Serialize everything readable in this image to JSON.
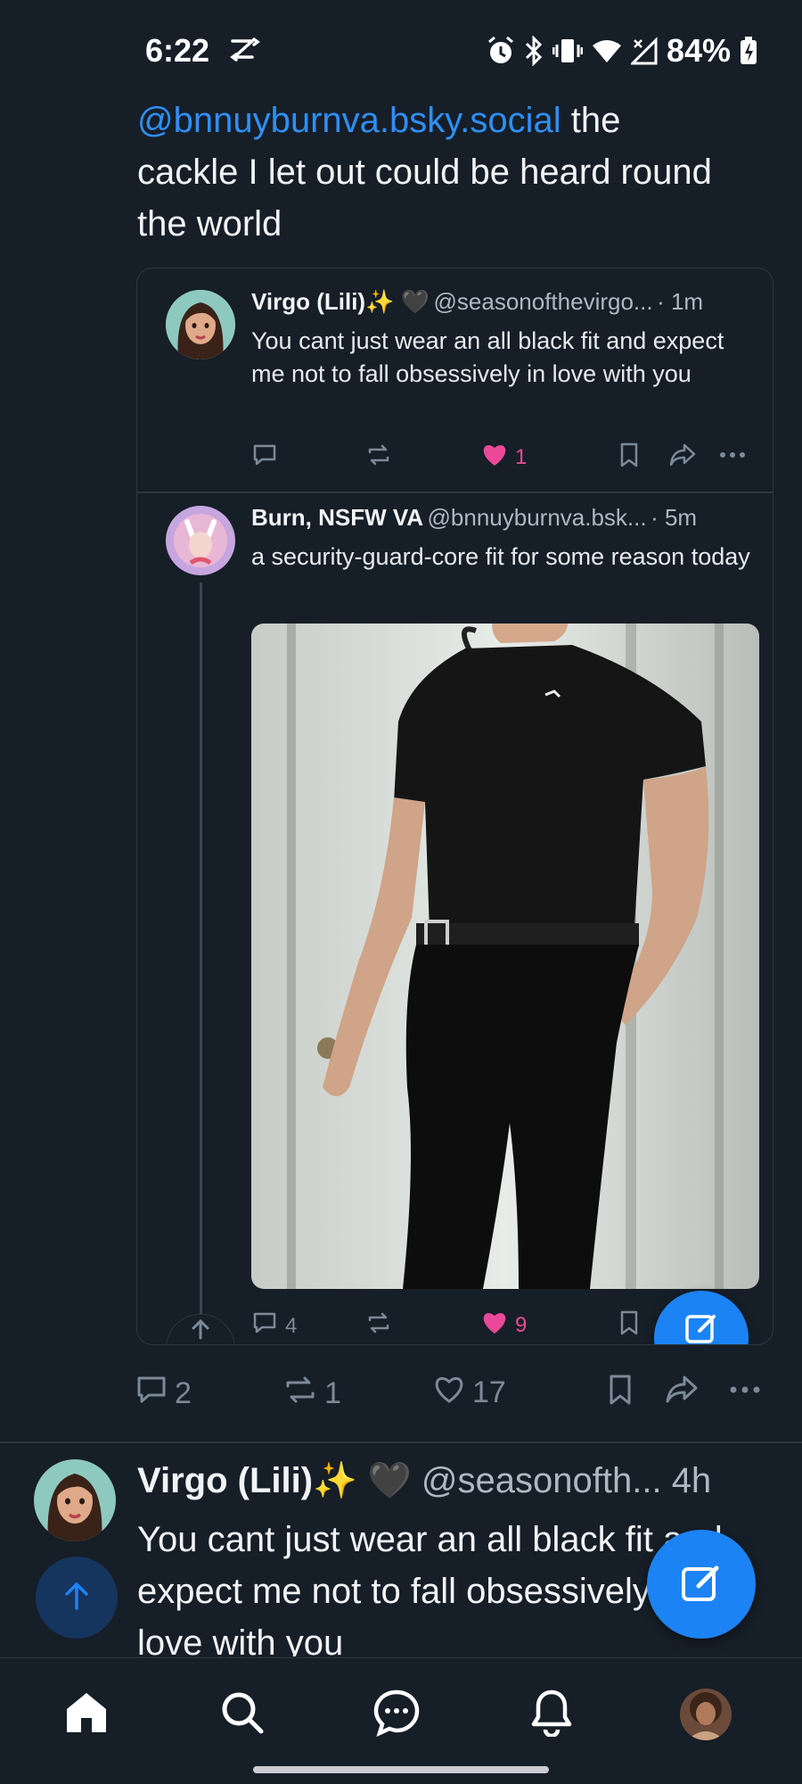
{
  "status_bar": {
    "time": "6:22",
    "battery": "84%",
    "icons": [
      "sync-icon",
      "alarm-icon",
      "bluetooth-icon",
      "vibrate-icon",
      "wifi-icon",
      "no-signal-icon",
      "battery-charging-icon"
    ]
  },
  "main_post": {
    "mention": "@bnnuyburnva.bsky.social",
    "text_after": " the cackle I let out could be heard round the world",
    "actions": {
      "replies": "2",
      "reposts": "1",
      "likes": "17"
    }
  },
  "quote_1": {
    "name": "Virgo (Lili)",
    "name_emojis": "✨ 🖤",
    "handle": "@seasonofthevirgo...",
    "time": "· 1m",
    "text": "You cant just wear an all black fit and expect me not to fall obsessively in love with you",
    "likes": "1"
  },
  "quote_2": {
    "name": "Burn, NSFW VA",
    "handle": "@bnnuyburnva.bsk...",
    "time": "· 5m",
    "text": "a security-guard-core fit for some reason today",
    "replies": "4",
    "likes": "9"
  },
  "next_post": {
    "name": "Virgo (Lili)",
    "name_emojis": "✨",
    "heart_emoji": "🖤",
    "handle": "@seasonofth...",
    "time": "4h",
    "text": "You cant just wear an all black fit and expect me not to fall obsessively in love with you"
  },
  "colors": {
    "background": "#161e27",
    "accent": "#1c83f4",
    "mention": "#2f8ff6",
    "like": "#ec4899",
    "muted": "#7b8a99"
  },
  "nav": [
    "home-icon",
    "search-icon",
    "chat-icon",
    "bell-icon",
    "profile-avatar"
  ]
}
